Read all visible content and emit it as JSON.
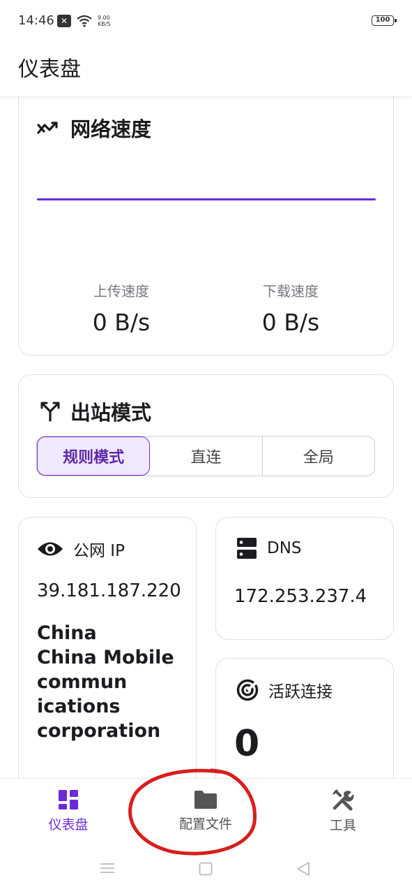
{
  "status_bar": {
    "time": "14:46",
    "net_speed_value": "9.00",
    "net_speed_unit": "KB/S",
    "battery": "100"
  },
  "header": {
    "title": "仪表盘"
  },
  "network_speed": {
    "title": "网络速度",
    "upload_label": "上传速度",
    "upload_value": "0 B/s",
    "download_label": "下载速度",
    "download_value": "0 B/s"
  },
  "outbound_mode": {
    "title": "出站模式",
    "options": [
      "规则模式",
      "直连",
      "全局"
    ],
    "selected": "规则模式"
  },
  "public_ip": {
    "title": "公网 IP",
    "value": "39.181.187.220",
    "isp_lines": [
      "China",
      "China Mobile",
      "commun",
      "ications",
      "corporation"
    ]
  },
  "dns": {
    "title": "DNS",
    "value": "172.253.237.4"
  },
  "active_connections": {
    "title": "活跃连接",
    "value": "0"
  },
  "bottom_nav": {
    "items": [
      {
        "label": "仪表盘",
        "icon": "dashboard-icon",
        "active": true
      },
      {
        "label": "配置文件",
        "icon": "folder-icon",
        "active": false
      },
      {
        "label": "工具",
        "icon": "tools-icon",
        "active": false
      }
    ]
  },
  "colors": {
    "accent": "#6c2bd9",
    "accent_bg": "#f1e9fb",
    "card_border": "#e1dde6",
    "annotation": "#d81e1e"
  }
}
